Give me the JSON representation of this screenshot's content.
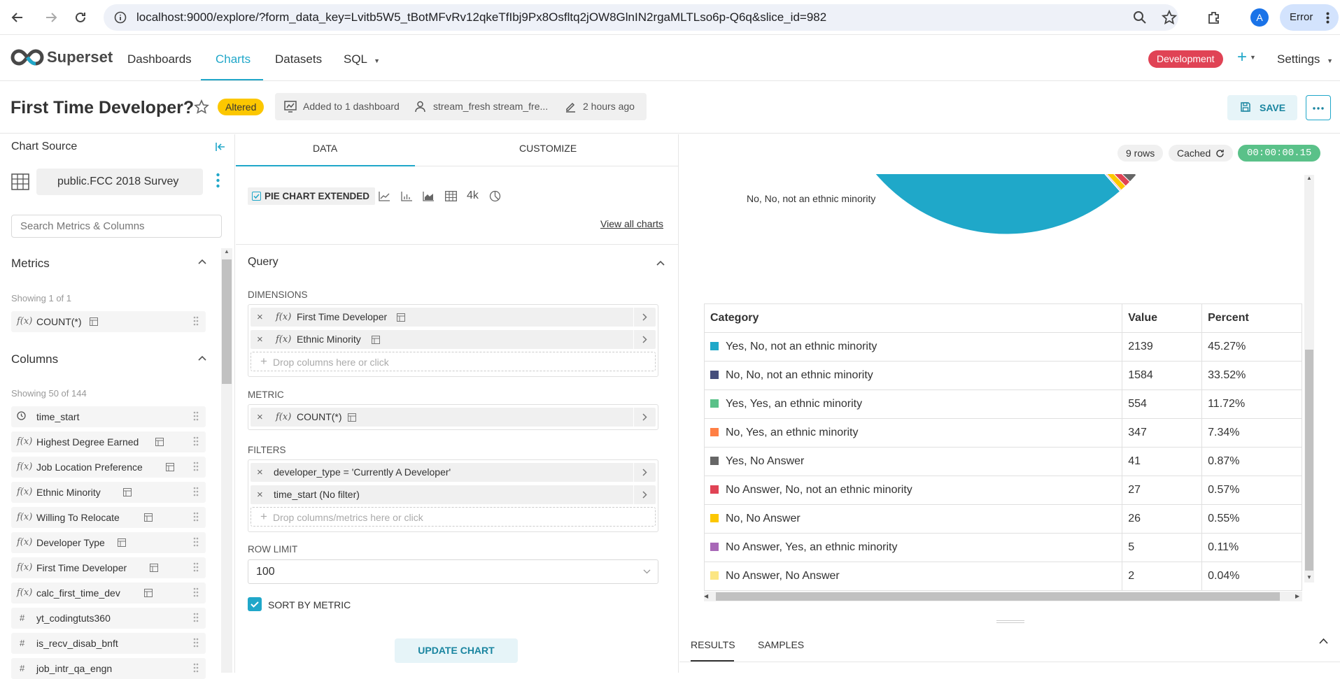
{
  "browser": {
    "url": "localhost:9000/explore/?form_data_key=Lvitb5W5_tBotMFvRv12qkeTfIbj9Px8Osfltq2jOW8GlnIN2rgaMLTLso6p-Q6q&slice_id=982",
    "avatar_letter": "A",
    "error_label": "Error"
  },
  "header": {
    "brand": "Superset",
    "nav": [
      "Dashboards",
      "Charts",
      "Datasets",
      "SQL"
    ],
    "env_badge": "Development",
    "plus": "+",
    "settings": "Settings"
  },
  "chart_header": {
    "title": "First Time Developer?",
    "status_badge": "Altered",
    "dashboards": "Added to 1 dashboard",
    "owner": "stream_fresh stream_fre...",
    "modified": "2 hours ago",
    "save_label": "SAVE"
  },
  "left_panel": {
    "title": "Chart Source",
    "dataset": "public.FCC 2018 Survey",
    "search_placeholder": "Search Metrics & Columns",
    "metrics_title": "Metrics",
    "metrics_count": "Showing 1 of 1",
    "metrics": [
      "COUNT(*)"
    ],
    "columns_title": "Columns",
    "columns_count": "Showing 50 of 144",
    "columns": [
      {
        "type": "time",
        "name": "time_start"
      },
      {
        "type": "fx",
        "name": "Highest Degree Earned"
      },
      {
        "type": "fx",
        "name": "Job Location Preference"
      },
      {
        "type": "fx",
        "name": "Ethnic Minority"
      },
      {
        "type": "fx",
        "name": "Willing To Relocate"
      },
      {
        "type": "fx",
        "name": "Developer Type"
      },
      {
        "type": "fx",
        "name": "First Time Developer"
      },
      {
        "type": "fx",
        "name": "calc_first_time_dev"
      },
      {
        "type": "num",
        "name": "yt_codingtuts360"
      },
      {
        "type": "num",
        "name": "is_recv_disab_bnft"
      },
      {
        "type": "num",
        "name": "job_intr_qa_engn"
      }
    ]
  },
  "mid_panel": {
    "tabs": [
      "DATA",
      "CUSTOMIZE"
    ],
    "viz_type": "PIE CHART EXTENDED",
    "viz_extra": "4k",
    "view_all": "View all charts",
    "query_title": "Query",
    "dimensions_label": "DIMENSIONS",
    "dimensions": [
      "First Time Developer",
      "Ethnic Minority"
    ],
    "dimensions_drop": "Drop columns here or click",
    "metric_label": "METRIC",
    "metric": "COUNT(*)",
    "filters_label": "FILTERS",
    "filters": [
      "developer_type = 'Currently A Developer'",
      "time_start (No filter)"
    ],
    "filters_drop": "Drop columns/metrics here or click",
    "row_limit_label": "ROW LIMIT",
    "row_limit": "100",
    "sort_by_metric": "SORT BY METRIC",
    "sort_by_metric_checked": true,
    "update_button": "UPDATE CHART"
  },
  "right_panel": {
    "rows_badge": "9 rows",
    "cached_badge": "Cached",
    "timer": "00:00:00.15",
    "pie_label": "No, No, not an ethnic minority",
    "table_headers": [
      "Category",
      "Value",
      "Percent"
    ],
    "bottom_tabs": [
      "RESULTS",
      "SAMPLES"
    ]
  },
  "chart_data": {
    "type": "table",
    "columns": [
      "Category",
      "Value",
      "Percent"
    ],
    "rows": [
      {
        "category": "Yes, No, not an ethnic minority",
        "value": 2139,
        "percent": "45.27%",
        "color": "#1fa8c9"
      },
      {
        "category": "No, No, not an ethnic minority",
        "value": 1584,
        "percent": "33.52%",
        "color": "#454e7c"
      },
      {
        "category": "Yes, Yes, an ethnic minority",
        "value": 554,
        "percent": "11.72%",
        "color": "#5ac189"
      },
      {
        "category": "No, Yes, an ethnic minority",
        "value": 347,
        "percent": "7.34%",
        "color": "#ff7f44"
      },
      {
        "category": "Yes, No Answer",
        "value": 41,
        "percent": "0.87%",
        "color": "#666666"
      },
      {
        "category": "No Answer, No, not an ethnic minority",
        "value": 27,
        "percent": "0.57%",
        "color": "#e04355"
      },
      {
        "category": "No, No Answer",
        "value": 26,
        "percent": "0.55%",
        "color": "#fcc700"
      },
      {
        "category": "No Answer, Yes, an ethnic minority",
        "value": 5,
        "percent": "0.11%",
        "color": "#a868b7"
      },
      {
        "category": "No Answer, No Answer",
        "value": 2,
        "percent": "0.04%",
        "color": "#fce683"
      }
    ]
  }
}
